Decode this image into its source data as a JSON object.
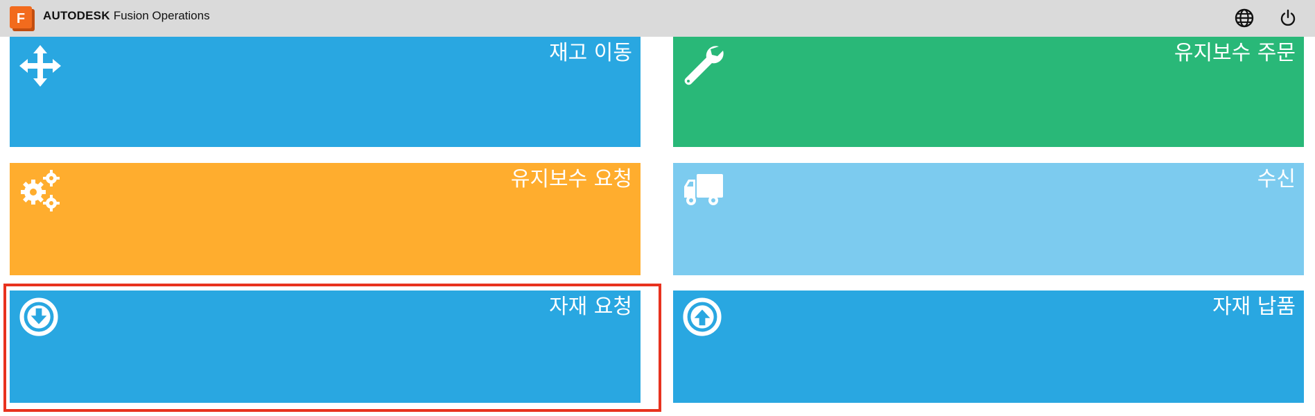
{
  "header": {
    "brand_bold": "AUTODESK",
    "brand_rest": "Fusion Operations",
    "logo_letter": "F",
    "globe_icon": "globe-icon",
    "power_icon": "power-icon"
  },
  "tiles": [
    {
      "label": "재고 이동",
      "icon": "move-arrows-icon",
      "color": "#29a7e1"
    },
    {
      "label": "유지보수 주문",
      "icon": "wrench-icon",
      "color": "#29b878"
    },
    {
      "label": "유지보수 요청",
      "icon": "gears-icon",
      "color": "#ffad2e"
    },
    {
      "label": "수신",
      "icon": "truck-icon",
      "color": "#7ccbef"
    },
    {
      "label": "자재 요청",
      "icon": "arrow-circle-down-icon",
      "color": "#29a7e1",
      "highlighted": true
    },
    {
      "label": "자재 납품",
      "icon": "arrow-circle-up-icon",
      "color": "#29a7e1"
    }
  ],
  "colors": {
    "topbar": "#dadada",
    "highlight": "#e8321e",
    "logo": "#f26b1d"
  }
}
